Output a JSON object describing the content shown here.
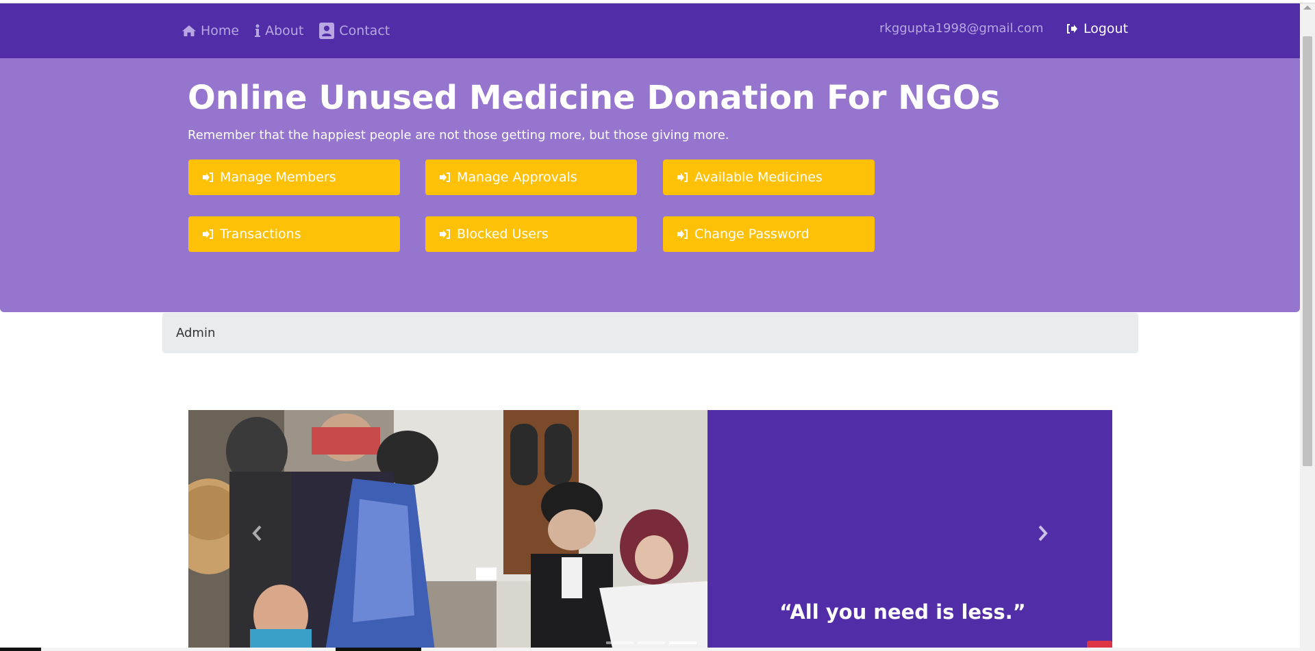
{
  "nav": {
    "home": "Home",
    "about": "About",
    "contact": "Contact",
    "email": "rkggupta1998@gmail.com",
    "logout": "Logout"
  },
  "jumbotron": {
    "title": "Online Unused Medicine Donation For NGOs",
    "subtitle": "Remember that the happiest people are not those getting more, but those giving more.",
    "buttons": [
      {
        "label": "Manage Members"
      },
      {
        "label": "Manage Approvals"
      },
      {
        "label": "Available Medicines"
      },
      {
        "label": "Transactions"
      },
      {
        "label": "Blocked Users"
      },
      {
        "label": "Change Password"
      }
    ]
  },
  "breadcrumb": {
    "text": "Admin"
  },
  "carousel": {
    "quote": "“All you need is less.”",
    "slides_count": 3,
    "active_slide": 3
  },
  "colors": {
    "nav_bg": "#512da8",
    "jumbotron_bg": "#9575cd",
    "button_bg": "#ffc107",
    "breadcrumb_bg": "#e9ecef"
  },
  "icons": {
    "home": "home-icon",
    "about": "info-icon",
    "contact": "contact-card-icon",
    "logout": "sign-out-icon",
    "button": "sign-in-icon",
    "prev": "chevron-left-icon",
    "next": "chevron-right-icon"
  }
}
